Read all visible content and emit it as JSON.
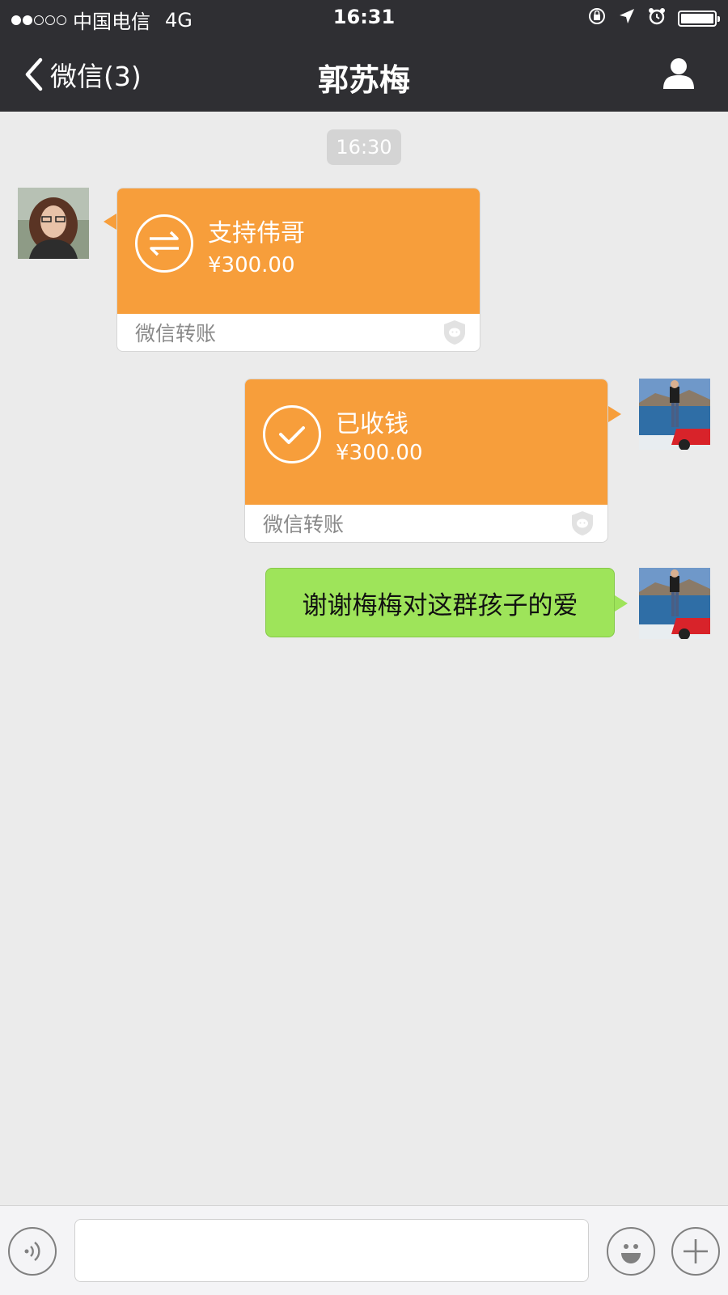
{
  "status_bar": {
    "signal_filled": 2,
    "signal_total": 5,
    "carrier": "中国电信",
    "network": "4G",
    "time": "16:31"
  },
  "nav": {
    "back_label": "微信(3)",
    "title": "郭苏梅",
    "profile_icon": "person-icon"
  },
  "chat": {
    "timestamp": "16:30",
    "messages": [
      {
        "side": "left",
        "type": "transfer",
        "icon": "transfer-arrows-icon",
        "desc": "支持伟哥",
        "amount": "¥300.00",
        "footer": "微信转账"
      },
      {
        "side": "right",
        "type": "transfer",
        "icon": "checkmark-icon",
        "desc": "已收钱",
        "amount": "¥300.00",
        "footer": "微信转账"
      },
      {
        "side": "right",
        "type": "text",
        "text": "谢谢梅梅对这群孩子的爱"
      }
    ]
  },
  "colors": {
    "header_bg": "#2f2f33",
    "transfer_orange": "#f79e3b",
    "sent_green": "#9ee45a",
    "chat_bg": "#ebebeb"
  },
  "input_bar": {
    "voice_icon": "voice-icon",
    "emoji_icon": "emoji-icon",
    "plus_icon": "plus-icon",
    "input_value": ""
  }
}
